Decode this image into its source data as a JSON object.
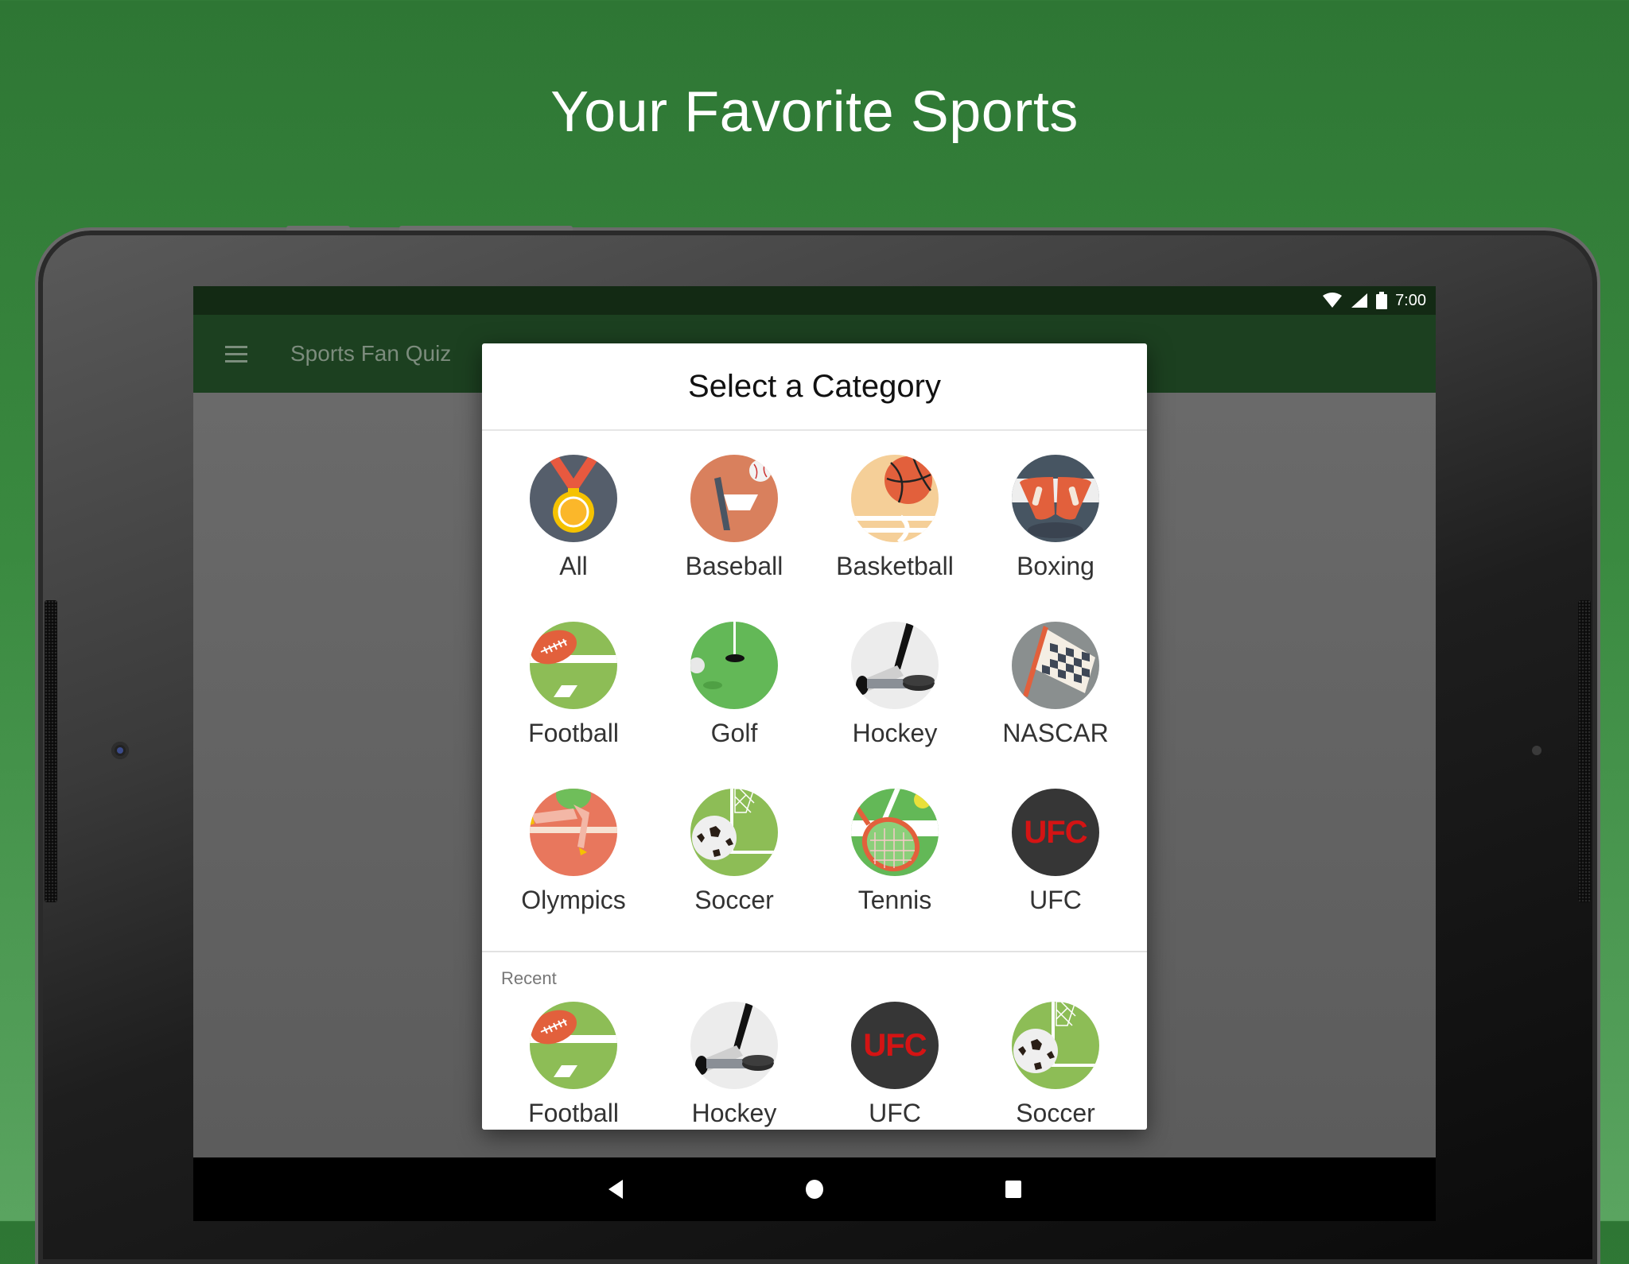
{
  "promo": {
    "title": "Your Favorite Sports"
  },
  "statusbar": {
    "time": "7:00",
    "icons": [
      "wifi-icon",
      "signal-icon",
      "battery-icon"
    ]
  },
  "appbar": {
    "menu_icon": "hamburger-menu-icon",
    "title": "Sports Fan Quiz"
  },
  "dialog": {
    "title": "Select a Category",
    "categories": [
      {
        "label": "All",
        "icon": "medal-icon"
      },
      {
        "label": "Baseball",
        "icon": "baseball-icon"
      },
      {
        "label": "Basketball",
        "icon": "basketball-icon"
      },
      {
        "label": "Boxing",
        "icon": "boxing-gloves-icon"
      },
      {
        "label": "Football",
        "icon": "football-icon"
      },
      {
        "label": "Golf",
        "icon": "golf-icon"
      },
      {
        "label": "Hockey",
        "icon": "hockey-icon"
      },
      {
        "label": "NASCAR",
        "icon": "checkered-flag-icon"
      },
      {
        "label": "Olympics",
        "icon": "hurdler-icon"
      },
      {
        "label": "Soccer",
        "icon": "soccer-ball-icon"
      },
      {
        "label": "Tennis",
        "icon": "tennis-racket-icon"
      },
      {
        "label": "UFC",
        "icon": "ufc-icon",
        "icon_text": "UFC"
      }
    ],
    "recent_label": "Recent",
    "recent": [
      {
        "label": "Football",
        "icon": "football-icon"
      },
      {
        "label": "Hockey",
        "icon": "hockey-icon"
      },
      {
        "label": "UFC",
        "icon": "ufc-icon",
        "icon_text": "UFC"
      },
      {
        "label": "Soccer",
        "icon": "soccer-ball-icon"
      }
    ]
  },
  "navbar": {
    "back": "back-icon",
    "home": "home-icon",
    "recents": "recents-icon"
  },
  "colors": {
    "background_green": "#2e7634",
    "appbar": "#1c4020",
    "statusbar": "#132a14",
    "ufc_red": "#d41414"
  }
}
